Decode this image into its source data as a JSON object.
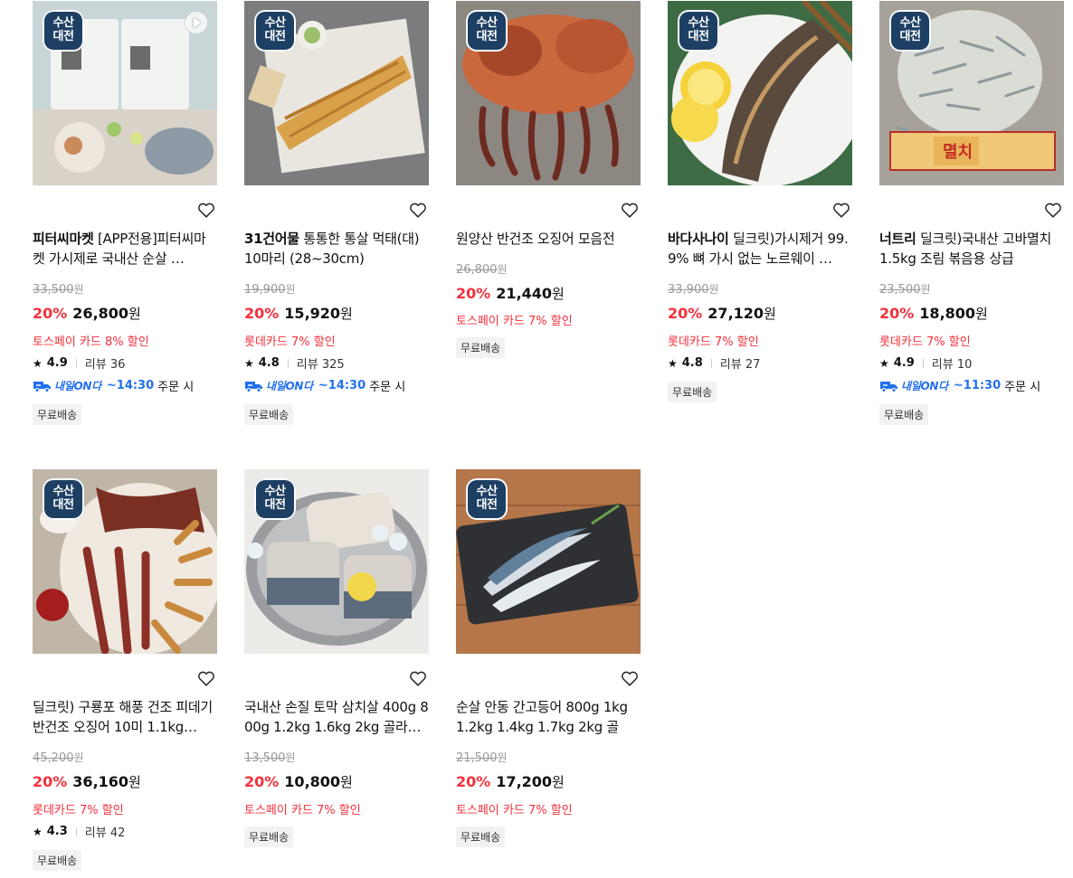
{
  "products": [
    {
      "badge": [
        "수산",
        "대전"
      ],
      "brand": "피터씨마켓",
      "name": "[APP전용]피터씨마켓 가시제로 국내산 순살 …",
      "original_price": "33,500",
      "discount_rate": "20%",
      "sale_price": "26,800",
      "currency": "원",
      "promo": "토스페이 카드 8% 할인",
      "rating": "4.9",
      "review_label": "리뷰 36",
      "delivery": {
        "service": "내일ON다",
        "time": "~14:30",
        "suffix": "주문 시"
      },
      "free_shipping": "무료배송",
      "has_video": true
    },
    {
      "badge": [
        "수산",
        "대전"
      ],
      "brand": "31건어물",
      "name": "통통한 통살 먹태(대) 10마리 (28~30cm)",
      "original_price": "19,900",
      "discount_rate": "20%",
      "sale_price": "15,920",
      "currency": "원",
      "promo": "롯데카드 7% 할인",
      "rating": "4.8",
      "review_label": "리뷰 325",
      "delivery": {
        "service": "내일ON다",
        "time": "~14:30",
        "suffix": "주문 시"
      },
      "free_shipping": "무료배송"
    },
    {
      "badge": [
        "수산",
        "대전"
      ],
      "brand": "",
      "name": "원양산 반건조 오징어 모음전",
      "original_price": "26,800",
      "discount_rate": "20%",
      "sale_price": "21,440",
      "currency": "원",
      "promo": "토스페이 카드 7% 할인",
      "free_shipping": "무료배송"
    },
    {
      "badge": [
        "수산",
        "대전"
      ],
      "brand": "바다사나이",
      "name": "딜크릿)가시제거 99.9% 뼈 가시 없는 노르웨이 …",
      "original_price": "33,900",
      "discount_rate": "20%",
      "sale_price": "27,120",
      "currency": "원",
      "promo": "롯데카드 7% 할인",
      "rating": "4.8",
      "review_label": "리뷰 27",
      "free_shipping": "무료배송"
    },
    {
      "badge": [
        "수산",
        "대전"
      ],
      "brand": "너트리",
      "name": "딜크릿)국내산 고바멸치 1.5kg 조림 볶음용 상급",
      "original_price": "23,500",
      "discount_rate": "20%",
      "sale_price": "18,800",
      "currency": "원",
      "promo": "롯데카드 7% 할인",
      "rating": "4.9",
      "review_label": "리뷰 10",
      "delivery": {
        "service": "내일ON다",
        "time": "~11:30",
        "suffix": "주문 시"
      },
      "free_shipping": "무료배송"
    },
    {
      "badge": [
        "수산",
        "대전"
      ],
      "brand": "",
      "name": "딜크릿) 구룡포 해풍 건조 피데기 반건조 오징어 10미 1.1kg…",
      "original_price": "45,200",
      "discount_rate": "20%",
      "sale_price": "36,160",
      "currency": "원",
      "promo": "롯데카드 7% 할인",
      "rating": "4.3",
      "review_label": "리뷰 42",
      "free_shipping": "무료배송"
    },
    {
      "badge": [
        "수산",
        "대전"
      ],
      "brand": "",
      "name": "국내산 손질 토막 삼치살 400g 800g 1.2kg 1.6kg 2kg 골라…",
      "original_price": "13,500",
      "discount_rate": "20%",
      "sale_price": "10,800",
      "currency": "원",
      "promo": "토스페이 카드 7% 할인",
      "free_shipping": "무료배송"
    },
    {
      "badge": [
        "수산",
        "대전"
      ],
      "brand": "",
      "name": "순살 안동 간고등어 800g 1kg 1.2kg 1.4kg 1.7kg 2kg 골라…",
      "original_price": "21,500",
      "discount_rate": "20%",
      "sale_price": "17,200",
      "currency": "원",
      "promo": "토스페이 카드 7% 할인",
      "free_shipping": "무료배송"
    }
  ],
  "colors": {
    "discount": "#f4303b",
    "delivery": "#2370ec",
    "badge": "#1d3f63"
  },
  "icons": [
    "heart-icon",
    "star-icon",
    "truck-icon",
    "play-icon"
  ]
}
